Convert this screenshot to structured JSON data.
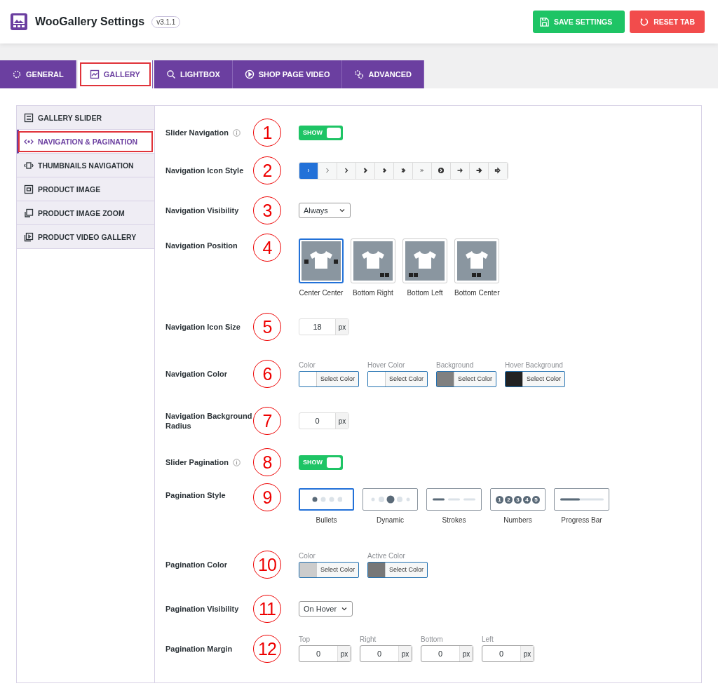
{
  "header": {
    "title": "WooGallery Settings",
    "version": "v3.1.1",
    "buttons": [
      {
        "label": "SAVE SETTINGS",
        "kind": "save"
      },
      {
        "label": "RESET TAB",
        "kind": "reset"
      }
    ]
  },
  "tabs": [
    {
      "label": "GENERAL",
      "selected": false,
      "highlighted": false
    },
    {
      "label": "GALLERY",
      "selected": true,
      "highlighted": true
    },
    {
      "label": "LIGHTBOX",
      "selected": false,
      "highlighted": false
    },
    {
      "label": "SHOP PAGE VIDEO",
      "selected": false,
      "highlighted": false
    },
    {
      "label": "ADVANCED",
      "selected": false,
      "highlighted": false
    }
  ],
  "sidebar": {
    "items": [
      {
        "label": "GALLERY SLIDER",
        "selected": false,
        "highlighted": false
      },
      {
        "label": "NAVIGATION & PAGINATION",
        "selected": true,
        "highlighted": true
      },
      {
        "label": "THUMBNAILS NAVIGATION",
        "selected": false,
        "highlighted": false
      },
      {
        "label": "PRODUCT IMAGE",
        "selected": false,
        "highlighted": false
      },
      {
        "label": "PRODUCT IMAGE ZOOM",
        "selected": false,
        "highlighted": false
      },
      {
        "label": "PRODUCT VIDEO GALLERY",
        "selected": false,
        "highlighted": false
      }
    ]
  },
  "settings": [
    {
      "kind": "toggle",
      "label": "Slider Navigation",
      "info": true,
      "marker": "1",
      "on": true,
      "text": "SHOW"
    },
    {
      "kind": "icon_style",
      "label": "Navigation Icon Style",
      "info": false,
      "marker": "2",
      "options": [
        {
          "selected": true
        },
        {
          "selected": false
        },
        {
          "selected": false
        },
        {
          "selected": false
        },
        {
          "selected": false
        },
        {
          "selected": false
        },
        {
          "selected": false
        },
        {
          "selected": false
        },
        {
          "selected": false
        },
        {
          "selected": false
        },
        {
          "selected": false
        }
      ]
    },
    {
      "kind": "select",
      "label": "Navigation Visibility",
      "info": false,
      "marker": "3",
      "value": "Always"
    },
    {
      "kind": "image_choice",
      "label": "Navigation Position",
      "info": false,
      "marker": "4",
      "options": [
        {
          "label": "Center Center",
          "selected": true
        },
        {
          "label": "Bottom Right",
          "selected": false
        },
        {
          "label": "Bottom Left",
          "selected": false
        },
        {
          "label": "Bottom Center",
          "selected": false
        }
      ]
    },
    {
      "kind": "number",
      "label": "Navigation Icon Size",
      "info": false,
      "marker": "5",
      "value": "18",
      "unit": "px"
    },
    {
      "kind": "colors",
      "label": "Navigation Color",
      "info": false,
      "marker": "6",
      "pickers": [
        {
          "label": "Color",
          "color": "#ffffff",
          "button": "Select Color"
        },
        {
          "label": "Hover Color",
          "color": "#ffffff",
          "button": "Select Color"
        },
        {
          "label": "Background",
          "color": "#808080",
          "button": "Select Color"
        },
        {
          "label": "Hover Background",
          "color": "#222222",
          "button": "Select Color"
        }
      ]
    },
    {
      "kind": "number",
      "label": "Navigation Background Radius",
      "info": false,
      "marker": "7",
      "value": "0",
      "unit": "px"
    },
    {
      "kind": "toggle",
      "label": "Slider Pagination",
      "info": true,
      "marker": "8",
      "on": true,
      "text": "SHOW"
    },
    {
      "kind": "style_choice",
      "label": "Pagination Style",
      "info": false,
      "marker": "9",
      "options": [
        {
          "label": "Bullets",
          "kind": "bullets",
          "selected": true
        },
        {
          "label": "Dynamic",
          "kind": "dynamic",
          "selected": false
        },
        {
          "label": "Strokes",
          "kind": "strokes",
          "selected": false
        },
        {
          "label": "Numbers",
          "kind": "numbers",
          "selected": false,
          "digits": [
            "1",
            "2",
            "3",
            "4",
            "5"
          ]
        },
        {
          "label": "Progress Bar",
          "kind": "progress",
          "selected": false
        }
      ]
    },
    {
      "kind": "colors",
      "label": "Pagination Color",
      "info": false,
      "marker": "10",
      "pickers": [
        {
          "label": "Color",
          "color": "#cccccc",
          "button": "Select Color"
        },
        {
          "label": "Active Color",
          "color": "#777777",
          "button": "Select Color"
        }
      ]
    },
    {
      "kind": "select",
      "label": "Pagination Visibility",
      "info": false,
      "marker": "11",
      "value": "On Hover"
    },
    {
      "kind": "margins",
      "label": "Pagination Margin",
      "info": false,
      "marker": "12",
      "fields": [
        {
          "label": "Top",
          "value": "0",
          "unit": "px"
        },
        {
          "label": "Right",
          "value": "0",
          "unit": "px"
        },
        {
          "label": "Bottom",
          "value": "0",
          "unit": "px"
        },
        {
          "label": "Left",
          "value": "0",
          "unit": "px"
        }
      ]
    }
  ]
}
